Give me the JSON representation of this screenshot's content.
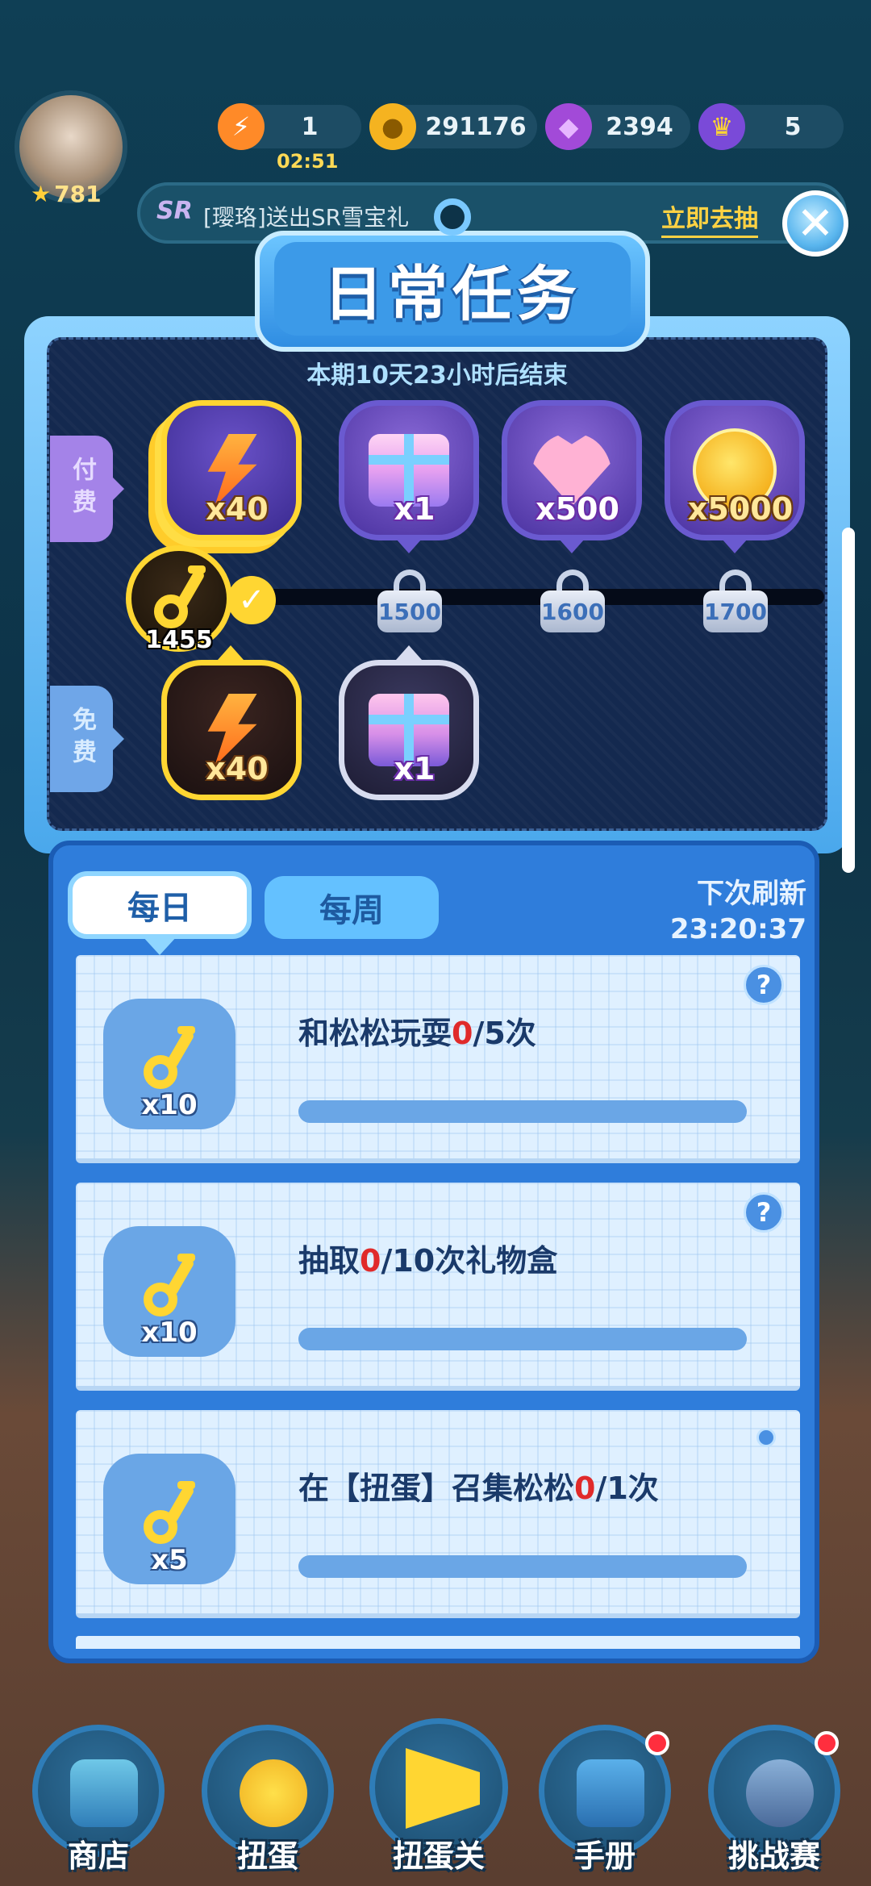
{
  "hud": {
    "level": "781",
    "energy": "1",
    "energy_timer": "02:51",
    "coins": "291176",
    "gems": "2394",
    "crowns": "5"
  },
  "marquee": {
    "badge": "SR",
    "text": "[璎珞]送出SR雪宝礼",
    "action": "立即去抽"
  },
  "title": "日常任务",
  "period_text": "本期10天23小时后结束",
  "tracks": {
    "paid_label": "付费",
    "free_label": "免费",
    "key_count": "1455",
    "paid_rewards": [
      {
        "icon": "energy-bolt-icon",
        "qty": "x40"
      },
      {
        "icon": "gift-box-icon",
        "qty": "x1"
      },
      {
        "icon": "heart-icon",
        "qty": "x500"
      },
      {
        "icon": "coin-icon",
        "qty": "x5000"
      }
    ],
    "free_rewards": [
      {
        "icon": "energy-bolt-icon",
        "qty": "x40"
      },
      {
        "icon": "gift-box-icon",
        "qty": "x1"
      }
    ],
    "milestones": [
      "1500",
      "1600",
      "1700"
    ]
  },
  "tasks_panel": {
    "tabs": [
      {
        "label": "每日",
        "active": true
      },
      {
        "label": "每周",
        "active": false
      }
    ],
    "refresh_label": "下次刷新",
    "refresh_time": "23:20:37",
    "tasks": [
      {
        "before": "和松松玩耍",
        "current": "0",
        "after": "/5次",
        "reward": "x10",
        "help": "?",
        "progress": 0
      },
      {
        "before": "抽取",
        "current": "0",
        "after": "/10次礼物盒",
        "reward": "x10",
        "help": "?",
        "progress": 0
      },
      {
        "before": "在【扭蛋】召集松松",
        "current": "0",
        "after": "/1次",
        "reward": "x5",
        "progress": 0
      }
    ]
  },
  "nav": [
    "商店",
    "扭蛋",
    "扭蛋关",
    "手册",
    "挑战赛"
  ],
  "colors": {
    "accent_gold": "#ffd632",
    "panel_blue": "#2f7ddb",
    "current_value_red": "#e02a2a"
  }
}
